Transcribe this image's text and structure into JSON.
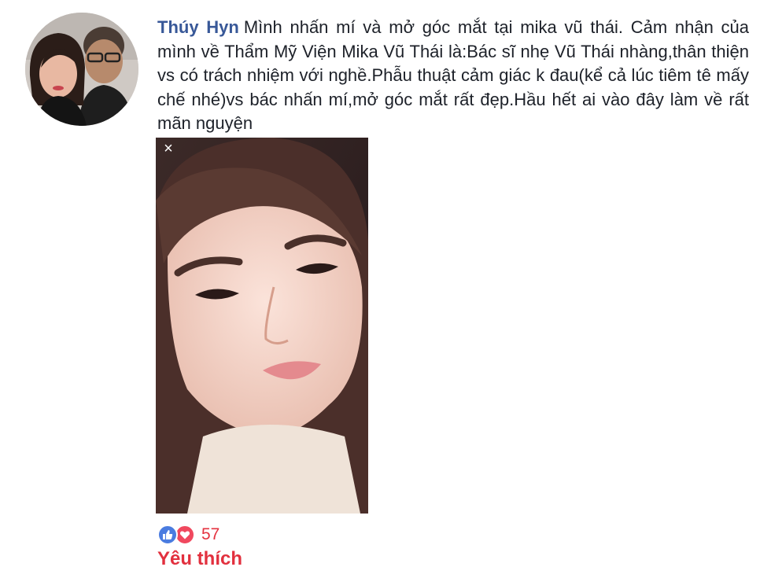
{
  "post": {
    "author": "Thúy Hyn",
    "text": "Mình nhấn mí và mở góc mắt tại mika vũ thái. Cảm nhận của mình về Thẩm Mỹ Viện Mika Vũ Thái là:Bác sĩ nhẹ Vũ Thái nhàng,thân thiện vs có trách nhiệm với nghề.Phẫu thuật cảm giác k đau(kể cả lúc tiêm tê mấy chế nhé)vs bác nhấn mí,mở góc mắt rất đẹp.Hầu hết ai vào đây làm về rất mãn nguyện"
  },
  "photo": {
    "close_glyph": "×",
    "icon": "close-icon"
  },
  "reactions": {
    "count": "57",
    "icons": [
      "like-icon",
      "love-icon"
    ],
    "like_color": "#4a7ce0",
    "love_color": "#f0485e"
  },
  "like_label": "Yêu thích",
  "colors": {
    "author": "#385898",
    "text": "#1d2129",
    "like_label": "#e2303e",
    "count": "#e4323f"
  }
}
